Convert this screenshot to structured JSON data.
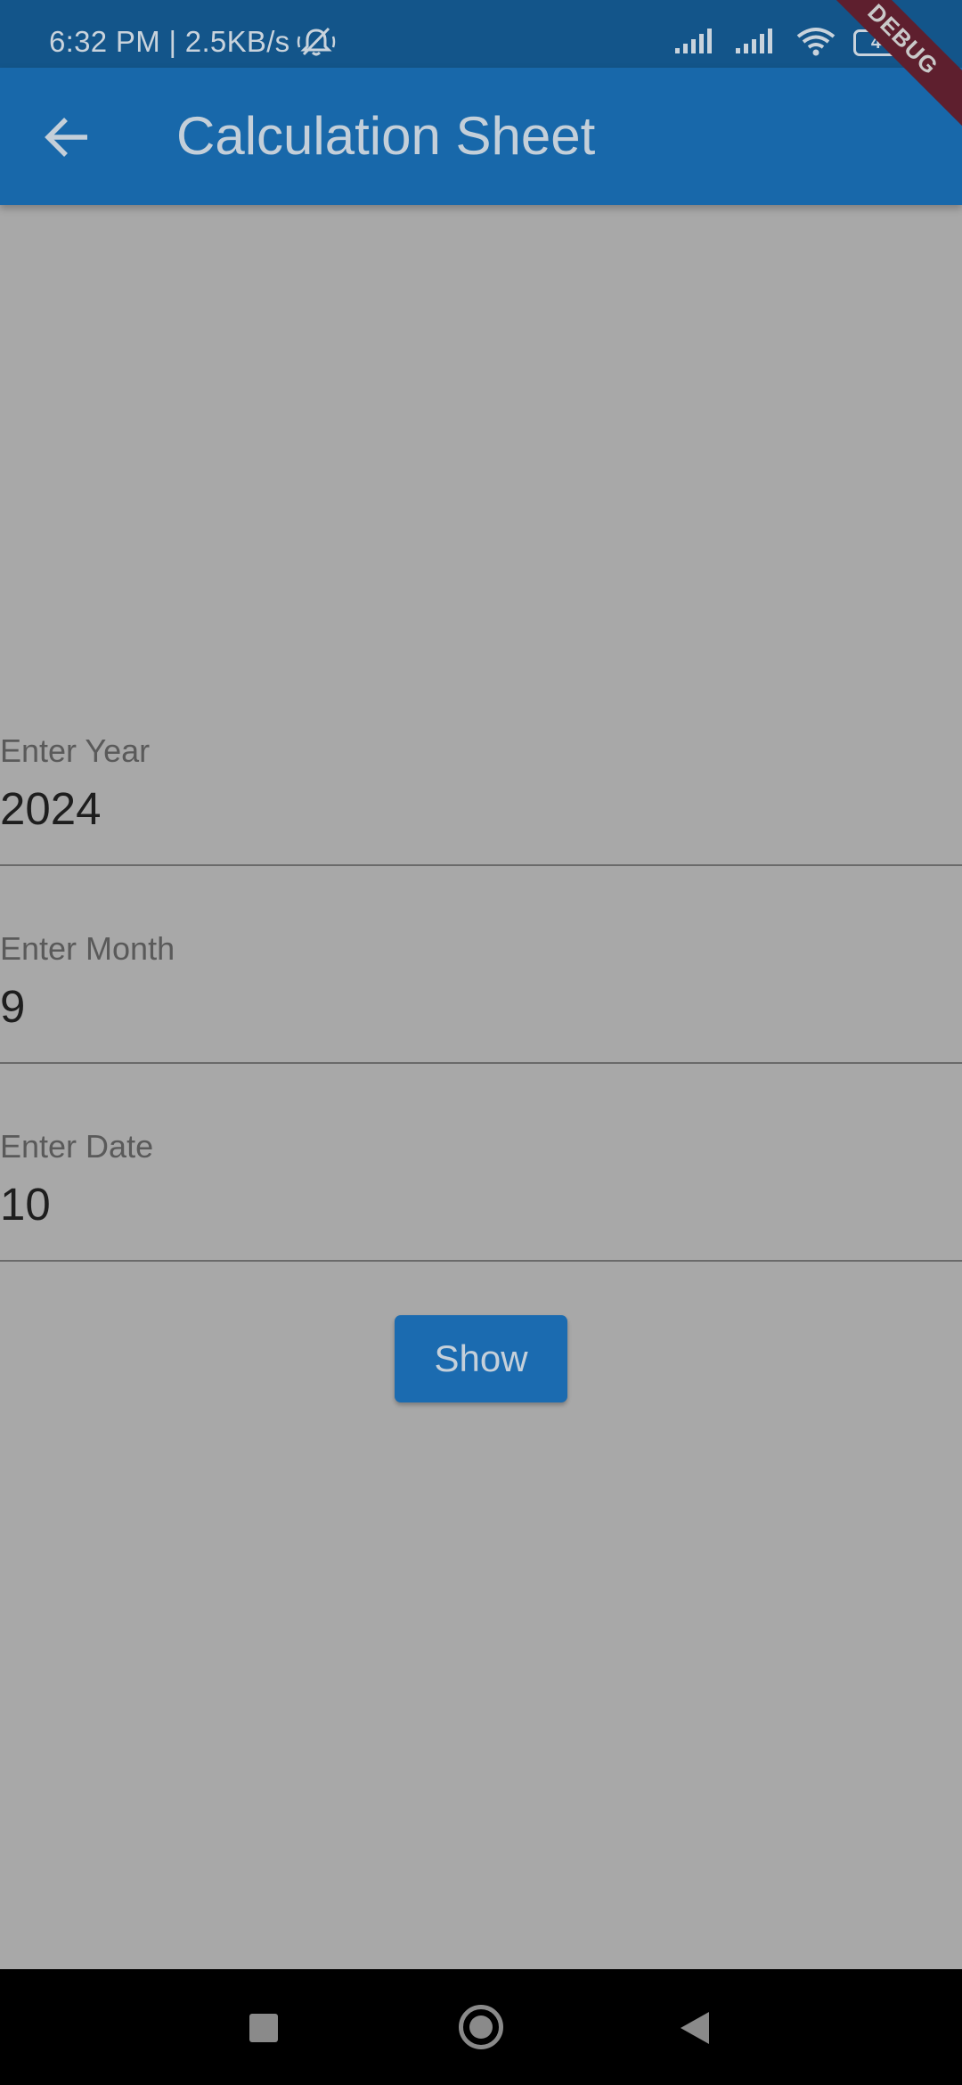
{
  "status_bar": {
    "time_speed": "6:32 PM | 2.5KB/s",
    "battery": "44",
    "icons": [
      "mute-icon",
      "signal-icon",
      "signal-icon",
      "wifi-icon",
      "battery-icon"
    ]
  },
  "app_bar": {
    "title": "Calculation Sheet",
    "back_icon": "arrow-back-icon"
  },
  "debug_banner": "DEBUG",
  "form": {
    "year": {
      "label": "Enter Year",
      "value": "2024"
    },
    "month": {
      "label": "Enter Month",
      "value": "9"
    },
    "date": {
      "label": "Enter Date",
      "value": "10"
    }
  },
  "show_button": {
    "label": "Show"
  },
  "nav_bar": {
    "icons": [
      "recents-icon",
      "home-icon",
      "back-icon"
    ]
  },
  "colors": {
    "app_bar": "#1868aa",
    "status_bar": "#13558a",
    "background": "#a8a8a8",
    "button": "#1b6bb0"
  }
}
